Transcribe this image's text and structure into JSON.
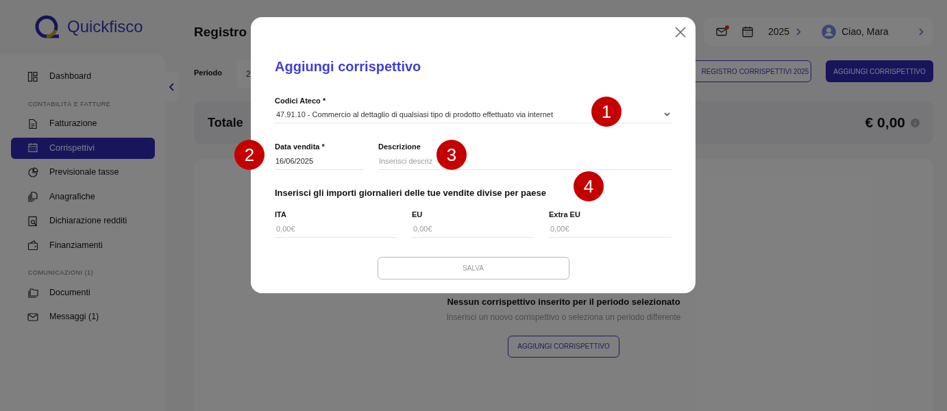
{
  "brand": {
    "name": "Quickfisco"
  },
  "sidebar": {
    "groups": [
      {
        "items": [
          {
            "label": "Dashboard",
            "selected": false
          }
        ]
      },
      {
        "heading": "CONTABILITÀ E FATTURE",
        "items": [
          {
            "label": "Fatturazione",
            "selected": false
          },
          {
            "label": "Corrispettivi",
            "selected": true
          },
          {
            "label": "Previsionale tasse",
            "selected": false
          },
          {
            "label": "Anagrafiche",
            "selected": false
          },
          {
            "label": "Dichiarazione redditi",
            "selected": false
          },
          {
            "label": "Finanziamenti",
            "selected": false
          }
        ]
      },
      {
        "heading": "COMUNICAZIONI (1)",
        "items": [
          {
            "label": "Documenti",
            "selected": false
          },
          {
            "label": "Messaggi (1)",
            "selected": false
          }
        ]
      }
    ]
  },
  "header": {
    "title": "Registro",
    "year": "2025",
    "greeting": "Ciao, Mara",
    "unread": true
  },
  "toolbar": {
    "period_label": "Periodo",
    "period_value": "2",
    "buttons": [
      {
        "label": "REGISTRO CORRISPETTIVI 2025",
        "kind": "outline"
      },
      {
        "label": "AGGIUNGI CORRISPETTIVO",
        "kind": "filled"
      }
    ]
  },
  "total": {
    "label": "Totale",
    "amount": "€ 0,00"
  },
  "empty_state": {
    "title": "Nessun corrispettivo inserito per il periodo selezionato",
    "text": "Inserisci un nuovo corrispettivo o seleziona un periodo differente",
    "button": "AGGIUNGI CORRISPETTIVO"
  },
  "dialog": {
    "title": "Aggiungi corrispettivo",
    "ateco": {
      "label": "Codici Ateco *",
      "value": "47.91.10 - Commercio al dettaglio di qualsiasi tipo di prodotto effettuato via internet"
    },
    "date": {
      "label": "Data vendita *",
      "value": "16/06/2025"
    },
    "description": {
      "label": "Descrizione",
      "placeholder": "Inserisci descriz"
    },
    "amounts_heading": "Inserisci gli importi giornalieri delle tue vendite divise per paese",
    "amounts": [
      {
        "label": "ITA",
        "placeholder": "0,00€"
      },
      {
        "label": "EU",
        "placeholder": "0,00€"
      },
      {
        "label": "Extra EU",
        "placeholder": "0,00€"
      }
    ],
    "save": {
      "label": "SALVA",
      "disabled": true
    }
  },
  "markers": [
    {
      "label": "1"
    },
    {
      "label": "2"
    },
    {
      "label": "3"
    },
    {
      "label": "4"
    }
  ]
}
